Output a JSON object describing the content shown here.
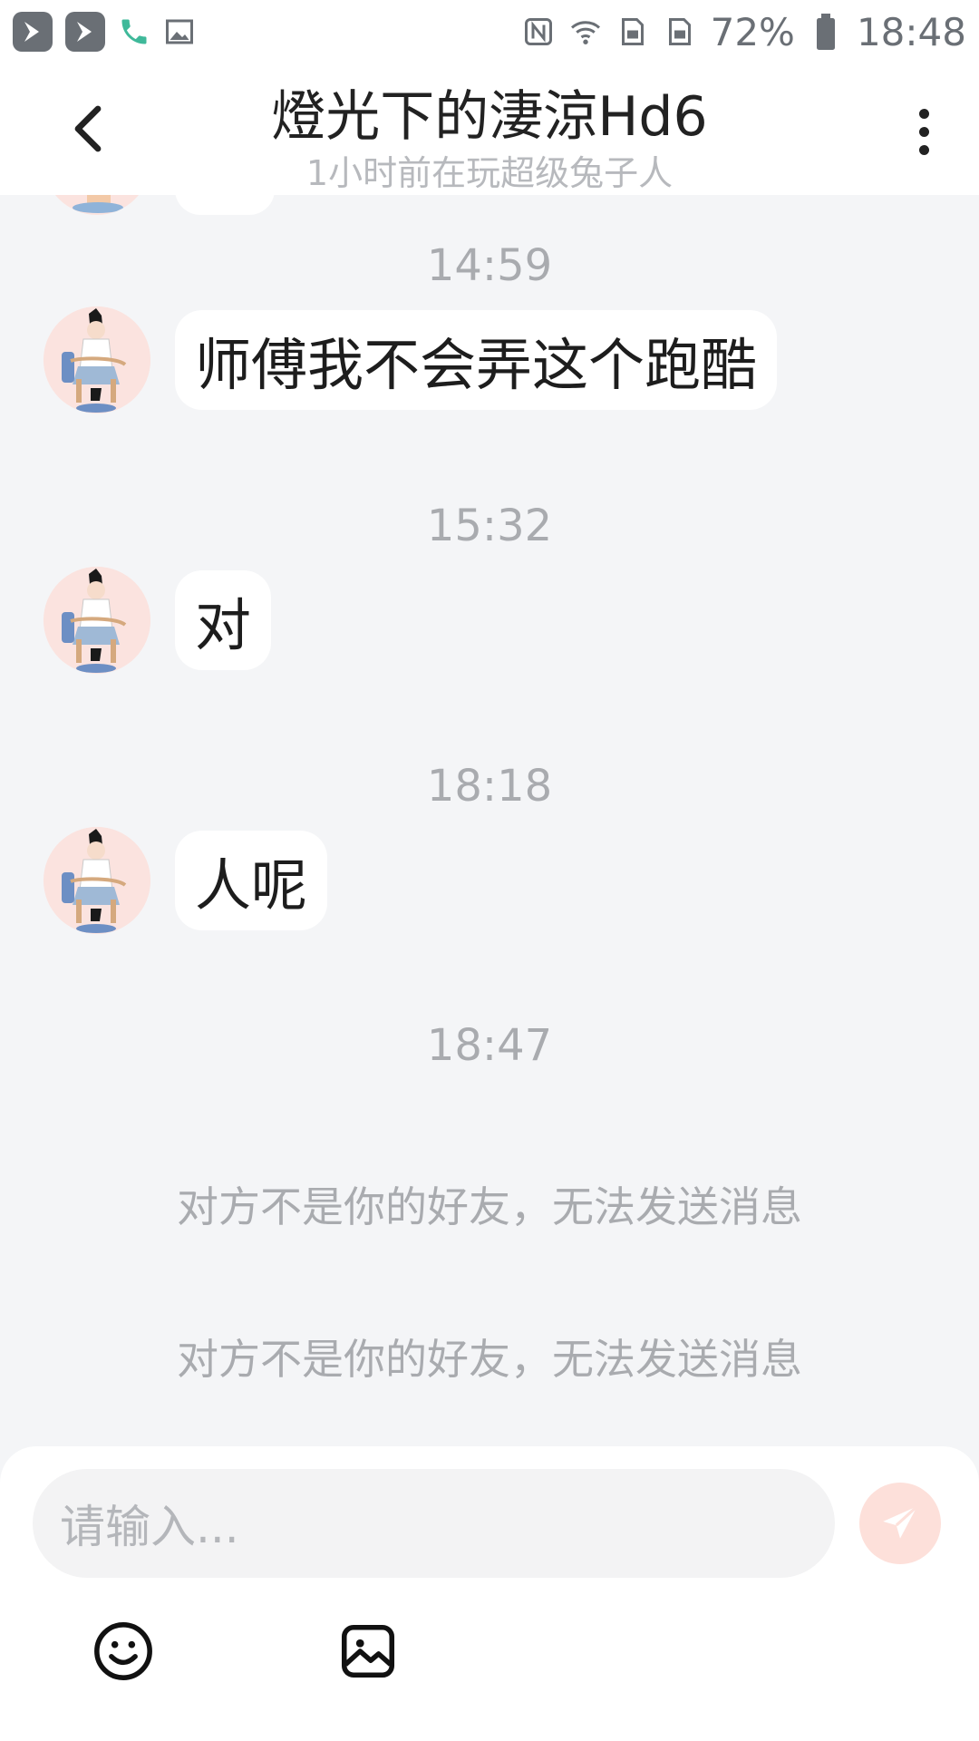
{
  "status_bar": {
    "battery": "72%",
    "time": "18:48",
    "icons_left": [
      "app-icon",
      "app-icon",
      "phone-icon",
      "image-icon"
    ],
    "icons_right": [
      "nfc-icon",
      "wifi-icon",
      "sim-icon",
      "sim-icon",
      "battery-icon"
    ]
  },
  "header": {
    "title": "燈光下的淒涼Hd6",
    "subtitle": "1小时前在玩超级兔子人",
    "back_icon": "chevron-left-icon",
    "more_icon": "more-vertical-icon"
  },
  "chat": {
    "messages": [
      {
        "time": "14:59",
        "text": "师傅我不会弄这个跑酷"
      },
      {
        "time": "15:32",
        "text": "对"
      },
      {
        "time": "18:18",
        "text": "人呢"
      }
    ],
    "final_time": "18:47",
    "system_notes": [
      "对方不是你的好友，无法发送消息",
      "对方不是你的好友，无法发送消息"
    ]
  },
  "composer": {
    "placeholder": "请输入...",
    "send_icon": "send-icon",
    "emoji_icon": "emoji-icon",
    "image_icon": "image-icon"
  },
  "colors": {
    "background": "#f4f5f7",
    "bubble": "#ffffff",
    "muted_text": "#a9abaf",
    "send_button": "#fde0da",
    "send_arrow": "#ffffff",
    "avatar_bg": "#fbe3df"
  }
}
